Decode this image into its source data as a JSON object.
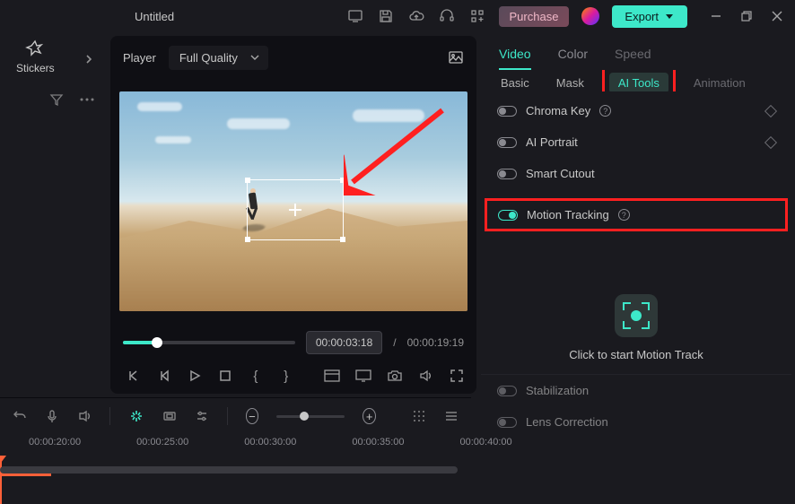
{
  "titlebar": {
    "title": "Untitled",
    "purchase_label": "Purchase",
    "export_label": "Export"
  },
  "sidebar": {
    "stickers_label": "Stickers"
  },
  "preview": {
    "player_label": "Player",
    "quality_label": "Full Quality",
    "time_current": "00:00:03:18",
    "time_separator": "/",
    "time_total": "00:00:19:19"
  },
  "props": {
    "tabs_primary": {
      "video": "Video",
      "color": "Color",
      "speed": "Speed"
    },
    "tabs_secondary": {
      "basic": "Basic",
      "mask": "Mask",
      "ai_tools": "AI Tools",
      "animation": "Animation"
    },
    "chroma_key": "Chroma Key",
    "ai_portrait": "AI Portrait",
    "smart_cutout": "Smart Cutout",
    "motion_tracking": "Motion Tracking",
    "motion_track_cta": "Click to start Motion Track",
    "stabilization": "Stabilization",
    "lens_correction": "Lens Correction"
  },
  "timeline": {
    "marks": [
      "00:00:20:00",
      "00:00:25:00",
      "00:00:30:00",
      "00:00:35:00",
      "00:00:40:00"
    ]
  }
}
